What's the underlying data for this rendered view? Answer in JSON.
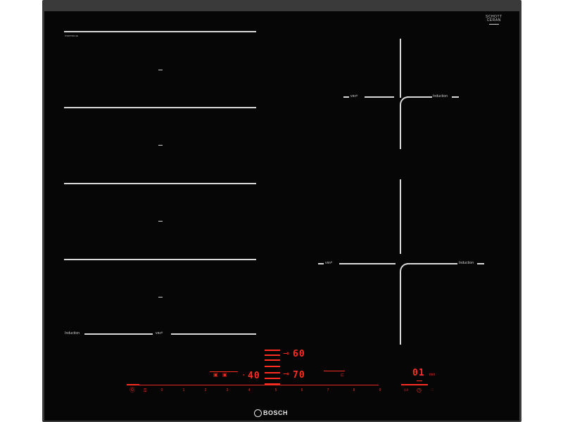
{
  "brand": {
    "line1": "SCHOTT",
    "line2": "CERAN"
  },
  "model_number": "PXE675DC1E",
  "manufacturer": "BOSCH",
  "left_zones": {
    "labels": [
      "Induction",
      "ᴠᴙᴧᴴ"
    ]
  },
  "right_zones": {
    "top": {
      "left_label": "ᴠᴙᴧᴴ",
      "right_label": "Induction"
    },
    "bottom": {
      "left_label": "ᴠᴙᴧᴴ",
      "right_label": "Induction"
    }
  },
  "display": {
    "power_level": "40",
    "temp_top": "60",
    "temp_bottom": "70",
    "timer": "01",
    "timer_unit": "min"
  },
  "power_scale": [
    "0",
    "1",
    "2",
    "3",
    "4",
    "5",
    "6",
    "7",
    "8",
    "9"
  ],
  "colors": {
    "accent": "#ff2d22",
    "glass": "#060606",
    "lines": "#d8d8d8"
  }
}
